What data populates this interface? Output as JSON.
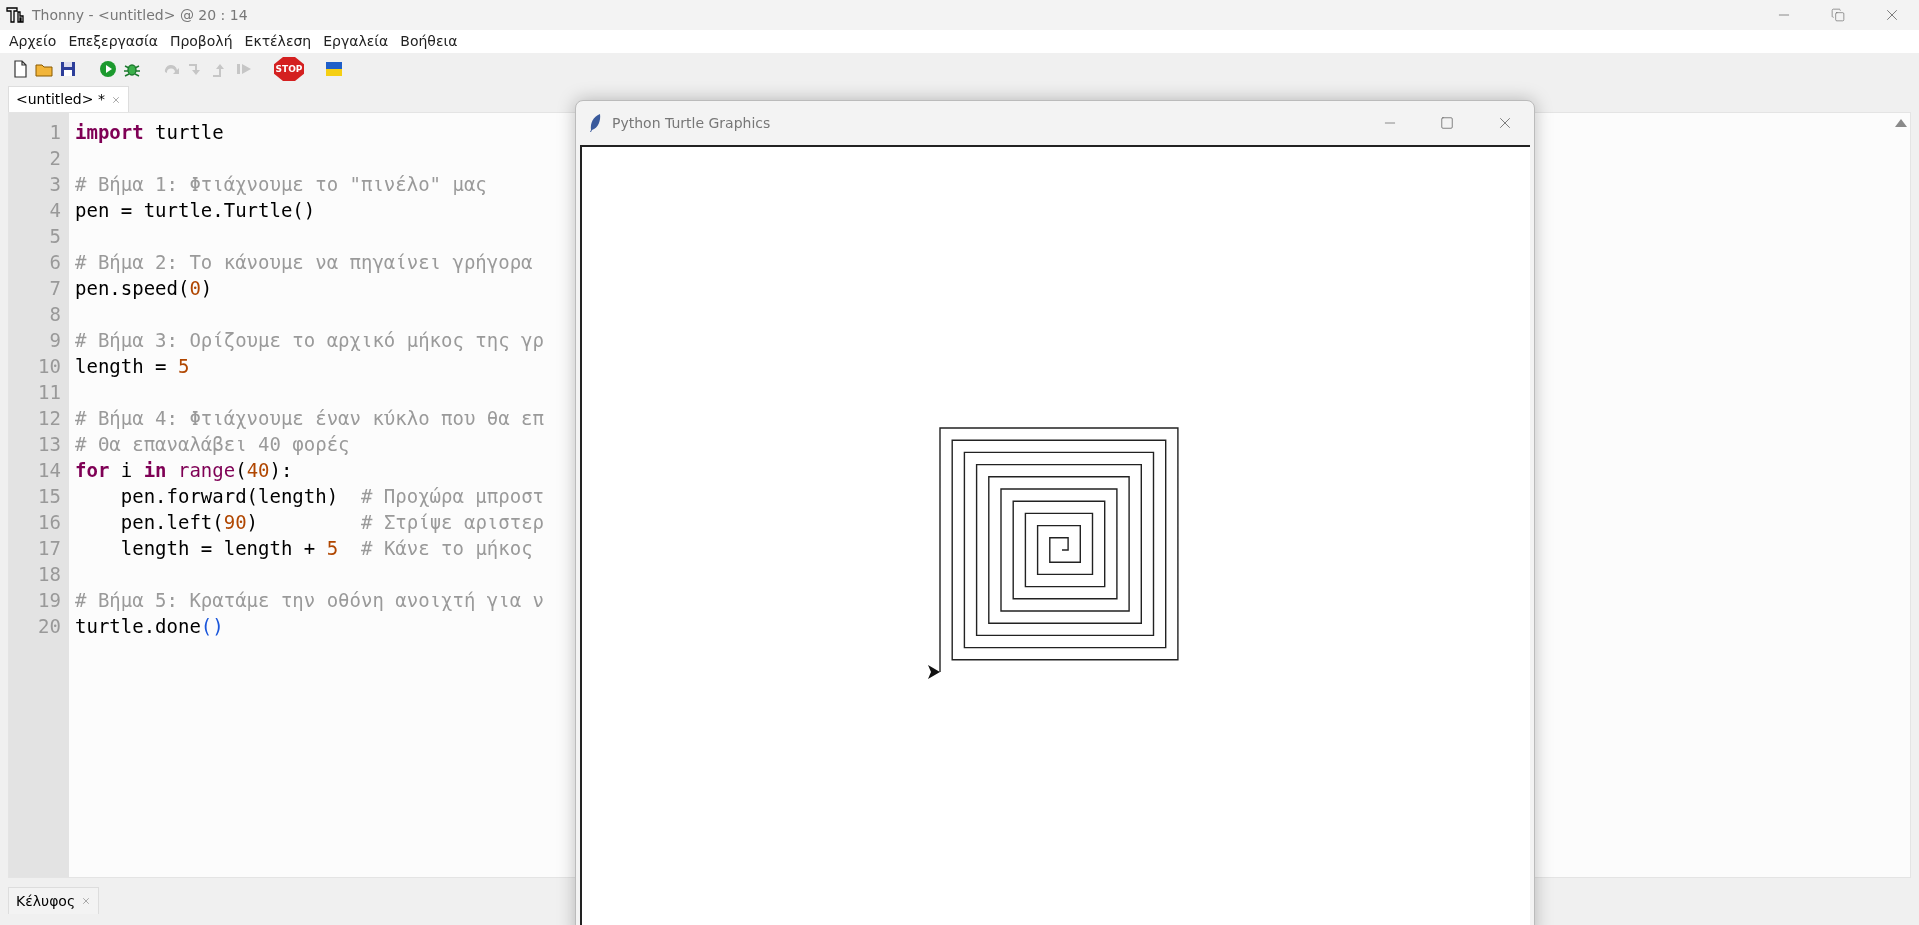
{
  "window": {
    "title": "Thonny  -  <untitled>  @  20 : 14"
  },
  "menu": [
    "Αρχείο",
    "Επεξεργασία",
    "Προβολή",
    "Εκτέλεση",
    "Εργαλεία",
    "Βοήθεια"
  ],
  "toolbar": [
    {
      "kind": "new",
      "disabled": false
    },
    {
      "kind": "open",
      "disabled": false
    },
    {
      "kind": "save",
      "disabled": false
    },
    {
      "kind": "run",
      "disabled": false
    },
    {
      "kind": "debug",
      "disabled": false
    },
    {
      "kind": "step_over",
      "disabled": true
    },
    {
      "kind": "step_into",
      "disabled": true
    },
    {
      "kind": "step_out",
      "disabled": true
    },
    {
      "kind": "resume",
      "disabled": true
    },
    {
      "kind": "stop",
      "disabled": false,
      "label": "STOP"
    },
    {
      "kind": "flag",
      "disabled": false
    }
  ],
  "editor_tabs": [
    {
      "label": "<untitled> *",
      "selected": true
    }
  ],
  "editor": {
    "lines": [
      {
        "number": "1",
        "tokens": [
          {
            "kind": "keyword",
            "text": "import"
          },
          {
            "kind": "plain",
            "text": " turtle"
          }
        ]
      },
      {
        "number": "2"
      },
      {
        "number": "3",
        "tokens": [
          {
            "kind": "comment",
            "text": "# Βήμα 1: Φτιάχνουμε το \"πινέλο\" μας"
          }
        ]
      },
      {
        "number": "4",
        "tokens": [
          {
            "kind": "plain",
            "text": "pen = turtle.Turtle()"
          }
        ]
      },
      {
        "number": "5"
      },
      {
        "number": "6",
        "tokens": [
          {
            "kind": "comment",
            "text": "# Βήμα 2: Το κάνουμε να πηγαίνει γρήγορα"
          }
        ]
      },
      {
        "number": "7",
        "tokens": [
          {
            "kind": "plain",
            "text": "pen.speed("
          },
          {
            "kind": "number",
            "text": "0"
          },
          {
            "kind": "plain",
            "text": ")"
          }
        ]
      },
      {
        "number": "8"
      },
      {
        "number": "9",
        "tokens": [
          {
            "kind": "comment",
            "text": "# Βήμα 3: Ορίζουμε το αρχικό μήκος της γρ"
          }
        ]
      },
      {
        "number": "10",
        "tokens": [
          {
            "kind": "plain",
            "text": "length = "
          },
          {
            "kind": "number",
            "text": "5"
          }
        ]
      },
      {
        "number": "11"
      },
      {
        "number": "12",
        "tokens": [
          {
            "kind": "comment",
            "text": "# Βήμα 4: Φτιάχνουμε έναν κύκλο που θα επ"
          }
        ]
      },
      {
        "number": "13",
        "tokens": [
          {
            "kind": "comment",
            "text": "# Θα επαναλάβει 40 φορές"
          }
        ]
      },
      {
        "number": "14",
        "tokens": [
          {
            "kind": "keyword",
            "text": "for"
          },
          {
            "kind": "plain",
            "text": " i "
          },
          {
            "kind": "keyword",
            "text": "in"
          },
          {
            "kind": "builtin",
            "text": " range"
          },
          {
            "kind": "plain",
            "text": "("
          },
          {
            "kind": "number",
            "text": "40"
          },
          {
            "kind": "plain",
            "text": "):"
          }
        ]
      },
      {
        "number": "15",
        "tokens": [
          {
            "kind": "plain",
            "text": "    pen.forward(length)  "
          },
          {
            "kind": "comment",
            "text": "# Προχώρα μπροστ"
          }
        ]
      },
      {
        "number": "16",
        "tokens": [
          {
            "kind": "plain",
            "text": "    pen.left("
          },
          {
            "kind": "number",
            "text": "90"
          },
          {
            "kind": "plain",
            "text": ")         "
          },
          {
            "kind": "comment",
            "text": "# Στρίψε αριστερ"
          }
        ]
      },
      {
        "number": "17",
        "tokens": [
          {
            "kind": "plain",
            "text": "    length = length + "
          },
          {
            "kind": "number",
            "text": "5"
          },
          {
            "kind": "comment",
            "text": "  # Κάνε το μήκος"
          }
        ]
      },
      {
        "number": "18"
      },
      {
        "number": "19",
        "tokens": [
          {
            "kind": "comment",
            "text": "# Βήμα 5: Κρατάμε την οθόνη ανοιχτή για ν"
          }
        ]
      },
      {
        "number": "20",
        "tokens": [
          {
            "kind": "plain",
            "text": "turtle.done"
          },
          {
            "kind": "paren",
            "text": "()"
          }
        ]
      }
    ]
  },
  "shell_tabs": [
    {
      "label": "Κέλυφος",
      "selected": true
    }
  ],
  "turtle_window": {
    "title": "Python Turtle Graphics"
  }
}
